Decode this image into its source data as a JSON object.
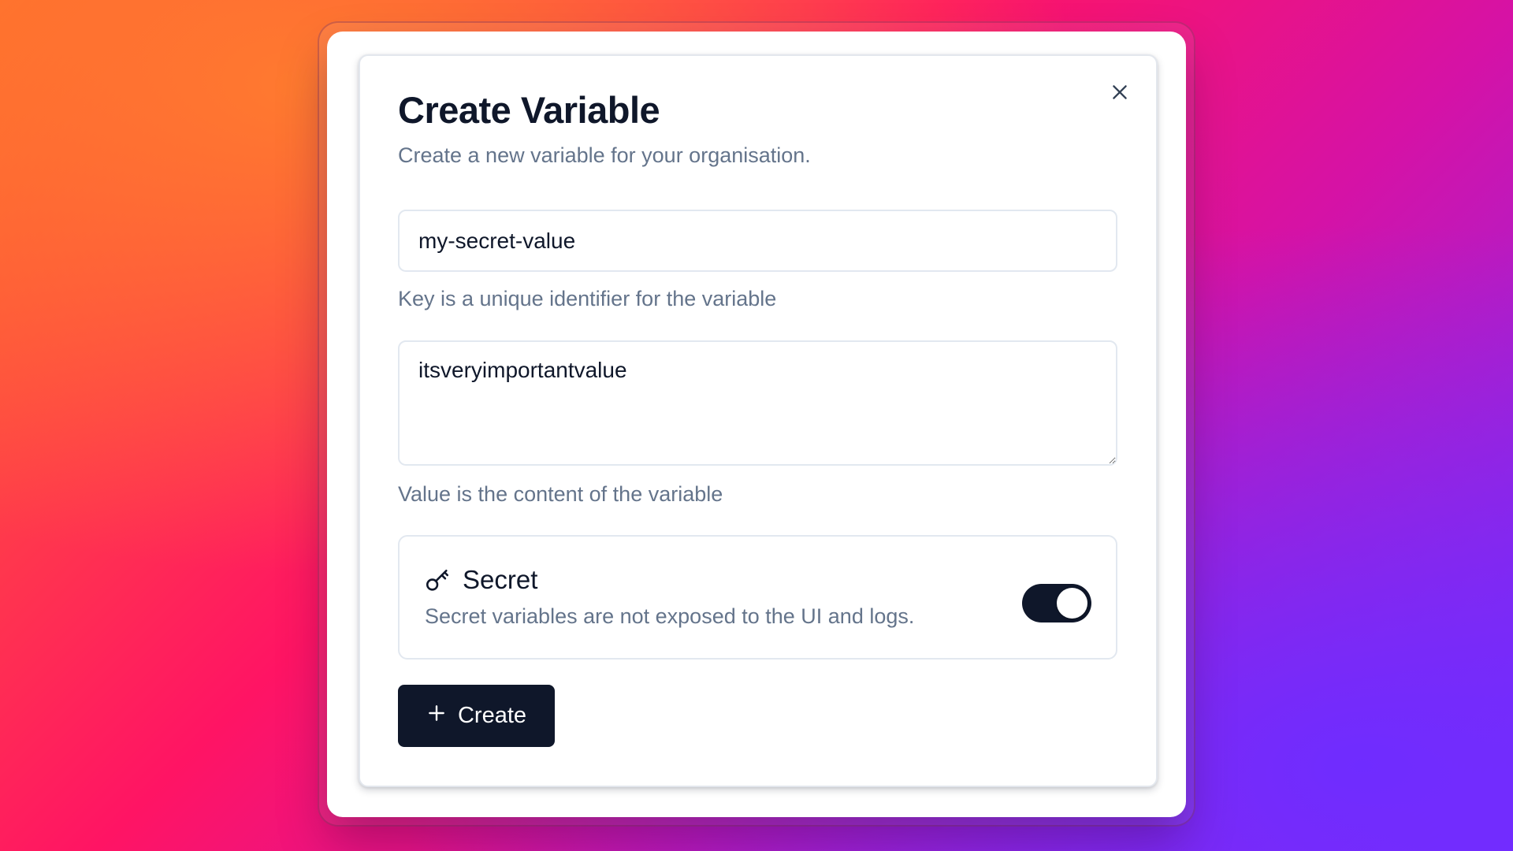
{
  "dialog": {
    "title": "Create Variable",
    "subtitle": "Create a new variable for your organisation.",
    "close_icon": "x-icon"
  },
  "key_field": {
    "value": "my-secret-value",
    "hint": "Key is a unique identifier for the variable"
  },
  "value_field": {
    "value": "itsveryimportantvalue",
    "hint": "Value is the content of the variable"
  },
  "secret": {
    "icon": "key-icon",
    "title": "Secret",
    "description": "Secret variables are not exposed to the UI and logs.",
    "enabled": true
  },
  "create_button": {
    "icon": "plus-icon",
    "label": "Create"
  },
  "colors": {
    "primary": "#0f172a",
    "muted_text": "#64748b",
    "border": "#e2e8f0"
  }
}
